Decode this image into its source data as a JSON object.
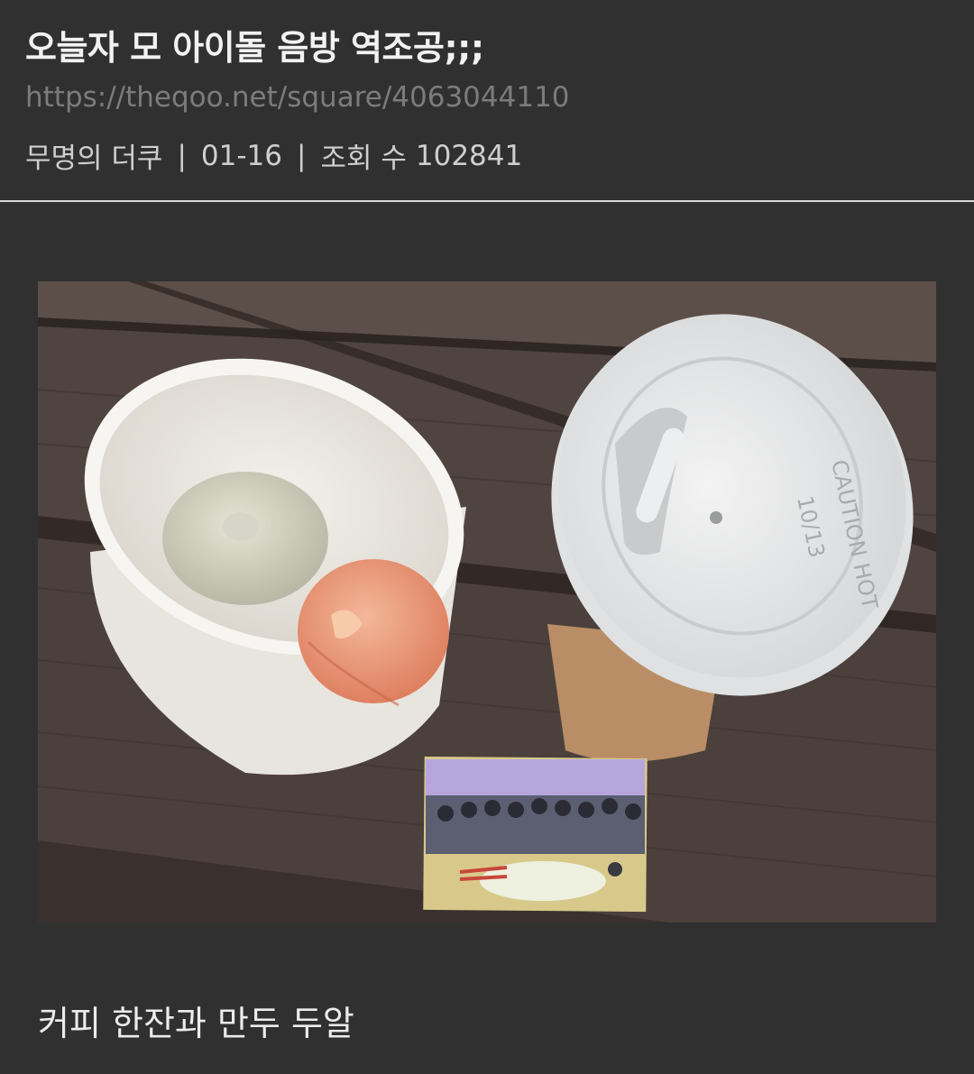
{
  "post": {
    "title": "오늘자 모 아이돌 음방 역조공;;;",
    "url": "https://theqoo.net/square/4063044110",
    "author": "무명의 더쿠",
    "date": "01-16",
    "views_label": "조회 수",
    "views": "102841",
    "separator": "|",
    "caption": "커피 한잔과 만두 두알"
  },
  "photo": {
    "lid_text_1": "CAUTION HOT",
    "lid_text_2": "10/13"
  }
}
